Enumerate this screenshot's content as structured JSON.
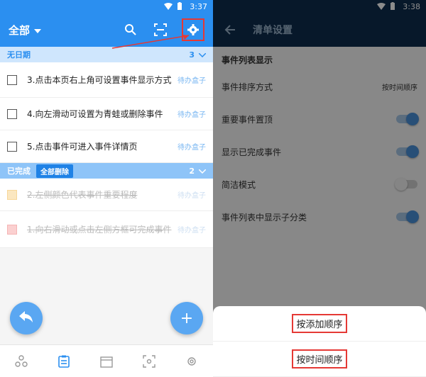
{
  "left": {
    "status_time": "3:37",
    "title": "全部",
    "sections": [
      {
        "label": "无日期",
        "count": "3",
        "tasks": [
          {
            "text": "3.点击本页右上角可设置事件显示方式",
            "tag": "待办盒子"
          },
          {
            "text": "4.向左滑动可设置为青蛙或删除事件",
            "tag": "待办盒子"
          },
          {
            "text": "5.点击事件可进入事件详情页",
            "tag": "待办盒子"
          }
        ]
      }
    ],
    "done_section": {
      "label": "已完成",
      "clear_button": "全部删除",
      "count": "2",
      "tasks": [
        {
          "text": "2.左侧颜色代表事件重要程度",
          "tag": "待办盒子"
        },
        {
          "text": "1.向右滑动或点击左侧方框可完成事件",
          "tag": "待办盒子"
        }
      ]
    },
    "fab_left_icon": "share-icon",
    "fab_right_label": "+"
  },
  "right": {
    "status_time": "3:38",
    "title": "清单设置",
    "section_label": "事件列表显示",
    "settings": [
      {
        "label": "事件排序方式",
        "value": "按时间顺序"
      },
      {
        "label": "重要事件置顶",
        "toggle": "on"
      },
      {
        "label": "显示已完成事件",
        "toggle": "on"
      },
      {
        "label": "简洁模式",
        "toggle": "off"
      },
      {
        "label": "事件列表中显示子分类",
        "toggle": "on"
      }
    ],
    "sheet_options": [
      "按添加顺序",
      "按时间顺序"
    ]
  },
  "colors": {
    "primary": "#2b8ff0",
    "dark_bar": "#0e2d4e",
    "highlight": "#e53935"
  }
}
